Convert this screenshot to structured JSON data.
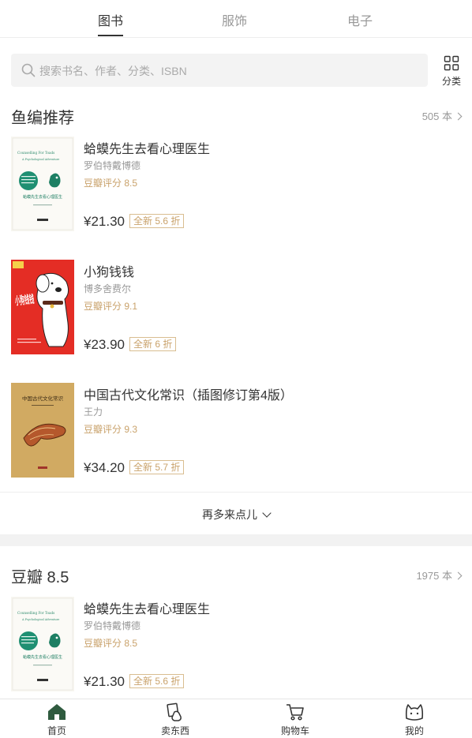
{
  "top_tabs": [
    "图书",
    "服饰",
    "电子"
  ],
  "search": {
    "placeholder": "搜索书名、作者、分类、ISBN"
  },
  "category_label": "分类",
  "sections": [
    {
      "title": "鱼编推荐",
      "count": "505 本",
      "books": [
        {
          "title": "蛤蟆先生去看心理医生",
          "author": "罗伯特戴博德",
          "rating": "豆瓣评分 8.5",
          "price": "¥21.30",
          "tag": "全新 5.6 折"
        },
        {
          "title": "小狗钱钱",
          "author": "博多舍费尔",
          "rating": "豆瓣评分 9.1",
          "price": "¥23.90",
          "tag": "全新 6 折"
        },
        {
          "title": "中国古代文化常识（插图修订第4版）",
          "author": "王力",
          "rating": "豆瓣评分 9.3",
          "price": "¥34.20",
          "tag": "全新 5.7 折"
        }
      ],
      "more_label": "再多来点儿"
    },
    {
      "title": "豆瓣 8.5",
      "count": "1975 本",
      "books": [
        {
          "title": "蛤蟆先生去看心理医生",
          "author": "罗伯特戴博德",
          "rating": "豆瓣评分 8.5",
          "price": "¥21.30",
          "tag": "全新 5.6 折"
        }
      ]
    }
  ],
  "covers": {
    "toad_en": "Counselling For Toads",
    "toad_cn": "蛤蟆先生去看心理医生",
    "dog_cn": "小狗钱钱",
    "culture_cn": "中国古代文化常识"
  },
  "bottom_nav": [
    "首页",
    "卖东西",
    "购物车",
    "我的"
  ],
  "colors": {
    "accent_green": "#2f5b3f",
    "rating": "#c9a26b",
    "dog_cover": "#e42d25",
    "culture_cover": "#d1aa62"
  }
}
